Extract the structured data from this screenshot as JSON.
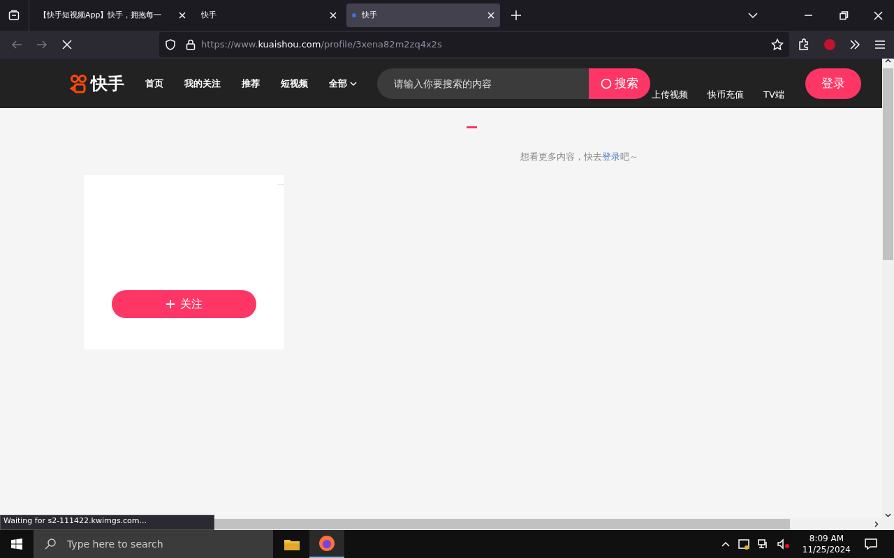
{
  "browser": {
    "tabs": [
      {
        "title": "【快手短视频App】快手，拥抱每一",
        "selected": false,
        "loading": false
      },
      {
        "title": "快手",
        "selected": false,
        "loading": false
      },
      {
        "title": "快手",
        "selected": true,
        "loading": true
      }
    ],
    "address": {
      "prefix": "https://www.",
      "host": "kuaishou.com",
      "path": "/profile/3xena82m2zq4x2s"
    },
    "status_text": "Waiting for s2-111422.kwimgs.com..."
  },
  "site": {
    "logo_text": "快手",
    "nav": [
      {
        "label": "首页",
        "kind": "link"
      },
      {
        "label": "我的关注",
        "kind": "link"
      },
      {
        "label": "推荐",
        "kind": "link"
      },
      {
        "label": "短视频",
        "kind": "link"
      },
      {
        "label": "全部",
        "kind": "dropdown"
      }
    ],
    "search": {
      "placeholder": "请输入你要搜索的内容",
      "button": "搜索"
    },
    "links": [
      "上传视频",
      "快币充值",
      "TV端"
    ],
    "login_button": "登录",
    "hint": {
      "before": "想看更多内容，快去",
      "link": "登录",
      "after": "吧～"
    },
    "profile_card": {
      "more": "···",
      "follow_button": "关注"
    }
  },
  "taskbar": {
    "search_placeholder": "Type here to search",
    "time": "8:09 AM",
    "date": "11/25/2024"
  }
}
